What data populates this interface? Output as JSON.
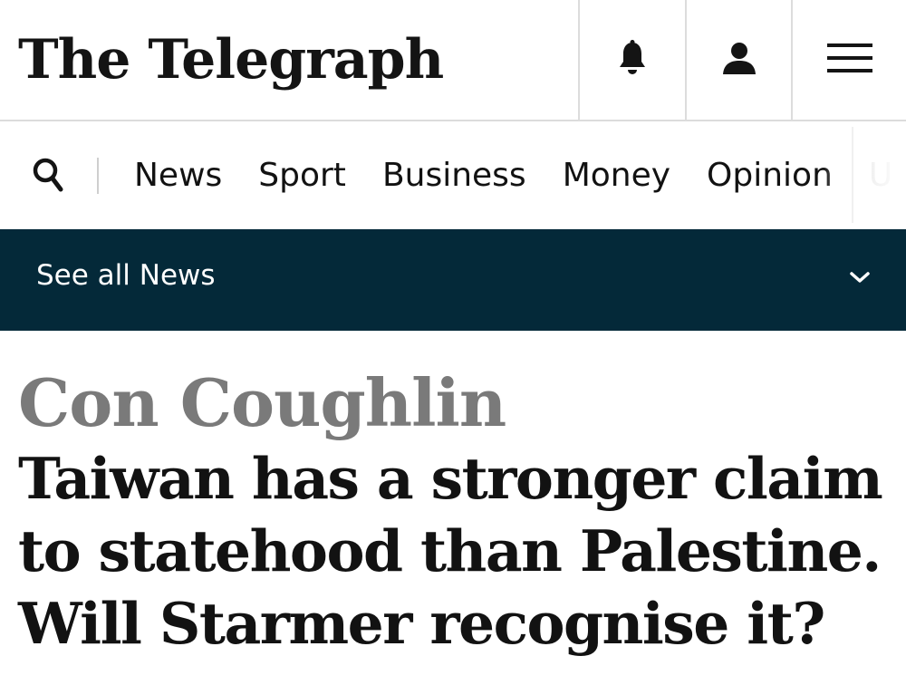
{
  "masthead": {
    "logo_text": "The Telegraph",
    "icons": [
      "bell-icon",
      "user-icon",
      "menu-icon"
    ]
  },
  "nav": {
    "search_icon": "search-icon",
    "items": [
      "News",
      "Sport",
      "Business",
      "Money",
      "Opinion",
      "U"
    ]
  },
  "section_bar": {
    "label": "See all News",
    "chevron_icon": "chevron-down-icon"
  },
  "article": {
    "byline": "Con Coughlin",
    "headline": "Taiwan has a stronger claim to statehood than Palestine. Will Starmer recognise it?"
  },
  "colors": {
    "section_bar_bg": "#042939",
    "byline": "#7a7a7a",
    "text": "#121212"
  }
}
